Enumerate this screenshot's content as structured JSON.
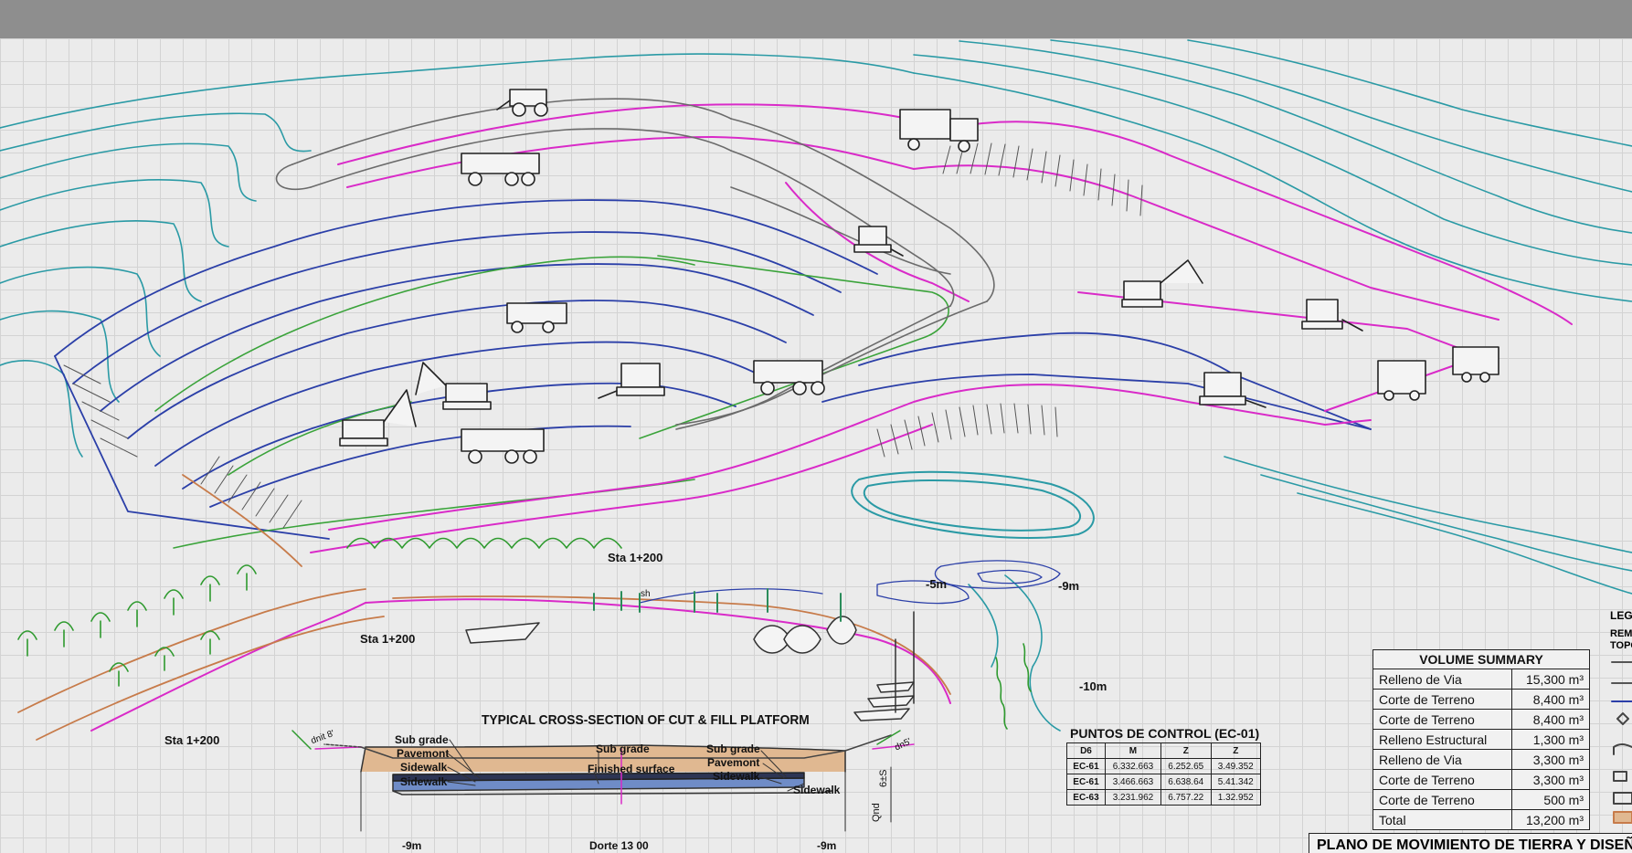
{
  "labels": {
    "sta_upper": "Sta 1+200",
    "sta_mid": "Sta 1+200",
    "sta_left": "Sta 1+200",
    "depth_5": "-5m",
    "depth_9": "-9m",
    "depth_10": "-10m",
    "bay_sh": "sh"
  },
  "cross_section": {
    "title": "TYPICAL CROSS-SECTION OF CUT & FILL PLATFORM",
    "left_labels": [
      "Sub grade",
      "Pavemont",
      "Sidewalk",
      "Sidewalk"
    ],
    "center_labels": [
      "Sub grade",
      "Finished surface"
    ],
    "right_labels": [
      "Sub grade",
      "Pavemont",
      "Sidewalk"
    ],
    "sidewalk_right": "Sidewalk",
    "bottom_left": "-9m",
    "bottom_center": "Dorte 13 00",
    "bottom_right": "-9m",
    "slope_left": "dnit 8'",
    "slope_right": "dn5'",
    "vertical_label": "Qnd",
    "vertical_value": "6±S"
  },
  "control_points": {
    "title": "PUNTOS DE CONTROL (EC-01)",
    "headers": [
      "D6",
      "M",
      "Z",
      "Z"
    ],
    "rows": [
      [
        "EC-61",
        "6.332.663",
        "6.252.65",
        "3.49.352"
      ],
      [
        "EC-61",
        "3.466.663",
        "6.638.64",
        "5.41.342"
      ],
      [
        "EC-63",
        "3.231.962",
        "6.757.22",
        "1.32.952"
      ]
    ]
  },
  "volume_summary": {
    "title": "VOLUME SUMMARY",
    "rows": [
      {
        "name": "Relleno de Via",
        "value": "15,300 m³"
      },
      {
        "name": "Corte de Terreno",
        "value": "8,400 m³"
      },
      {
        "name": "Corte de Terreno",
        "value": "8,400 m³"
      },
      {
        "name": "Relleno Estructural",
        "value": "1,300 m³"
      },
      {
        "name": "Relleno de Via",
        "value": "3,300 m³"
      },
      {
        "name": "Corte de Terreno",
        "value": "3,300 m³"
      },
      {
        "name": "Corte de Terreno",
        "value": "500 m³"
      },
      {
        "name": "Total",
        "value": "13,200 m³"
      }
    ]
  },
  "legend": {
    "title": "LEGI",
    "r1": "REMI",
    "r2": "TOPC"
  },
  "plan_title": "PLANO DE MOVIMIENTO DE TIERRA Y DISEÑO",
  "colors": {
    "contour_teal": "#2a9aa5",
    "contour_blue": "#2b3fa8",
    "boundary_magenta": "#d92ac8",
    "terrace_green": "#3aa33a",
    "haul_road": "#6b6b6b",
    "fill_brown": "#c77b4a"
  }
}
